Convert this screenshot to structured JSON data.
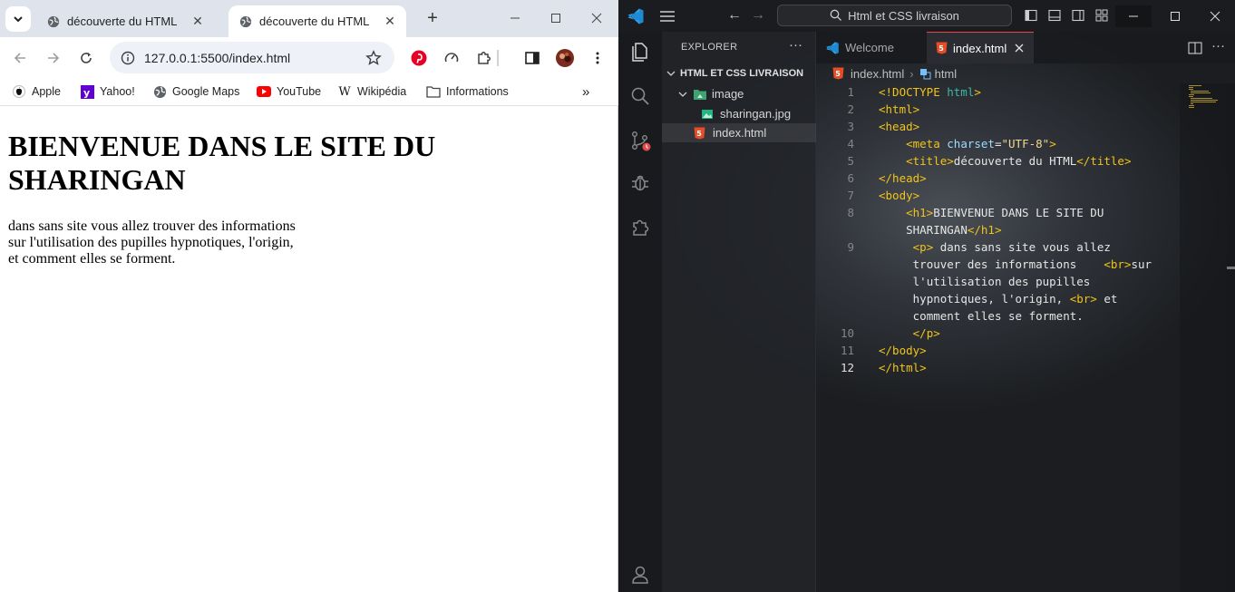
{
  "browser": {
    "tabs": [
      {
        "title": "découverte du HTML",
        "active": false
      },
      {
        "title": "découverte du HTML",
        "active": true
      }
    ],
    "url": "127.0.0.1:5500/index.html",
    "bookmarks": [
      {
        "label": "Apple",
        "icon": "apple-icon"
      },
      {
        "label": "Yahoo!",
        "icon": "yahoo-icon"
      },
      {
        "label": "Google Maps",
        "icon": "globe-icon"
      },
      {
        "label": "YouTube",
        "icon": "youtube-icon"
      },
      {
        "label": "Wikipédia",
        "icon": "wikipedia-icon"
      },
      {
        "label": "Informations",
        "icon": "folder-icon"
      }
    ],
    "page": {
      "heading": "BIENVENUE DANS LE SITE DU SHARINGAN",
      "paragraph_lines": [
        "dans sans site vous allez trouver des informations",
        "sur l'utilisation des pupilles hypnotiques, l'origin,",
        "et comment elles se forment."
      ]
    }
  },
  "vscode": {
    "command_center": "Html et CSS livraison",
    "explorer_title": "EXPLORER",
    "root_folder": "HTML ET CSS LIVRAISON",
    "tree": [
      {
        "label": "image",
        "type": "folder"
      },
      {
        "label": "sharingan.jpg",
        "type": "image"
      },
      {
        "label": "index.html",
        "type": "html"
      }
    ],
    "editor_tabs": [
      {
        "label": "Welcome"
      },
      {
        "label": "index.html"
      }
    ],
    "breadcrumb": {
      "file": "index.html",
      "symbol": "html"
    },
    "line_numbers": [
      "1",
      "2",
      "3",
      "4",
      "5",
      "6",
      "7",
      "8",
      "9",
      "10",
      "11",
      "12"
    ],
    "code": {
      "l1_doctype": "<!DOCTYPE",
      "l1_html": " html",
      "l1_close": ">",
      "l2": "<html>",
      "l3": "<head>",
      "l4_open": "<meta",
      "l4_attr": " charset",
      "l4_eq": "=",
      "l4_str": "\"UTF-8\"",
      "l4_close": ">",
      "l5_open": "<title>",
      "l5_text": "découverte du HTML",
      "l5_close": "</title>",
      "l6": "</head>",
      "l7": "<body>",
      "l8_open": "<h1>",
      "l8_text": "BIENVENUE DANS LE SITE DU",
      "l8b_text": "SHARINGAN",
      "l8b_close": "</h1>",
      "l9_open": "<p>",
      "l9_text1": " dans sans site vous allez",
      "l9b_text": "trouver des informations    ",
      "l9b_br": "<br>",
      "l9b_text2": "sur",
      "l9c_text": "l'utilisation des pupilles",
      "l9d_text": "hypnotiques, l'origin, ",
      "l9d_br": "<br>",
      "l9d_text2": " et",
      "l9e_text": "comment elles se forment.",
      "l10": "</p>",
      "l11": "</body>",
      "l12": "</html>"
    }
  },
  "colors": {
    "vscode_accent": "#0078d4",
    "tab_border": "#e9434b",
    "html_tag": "#f0c419"
  }
}
